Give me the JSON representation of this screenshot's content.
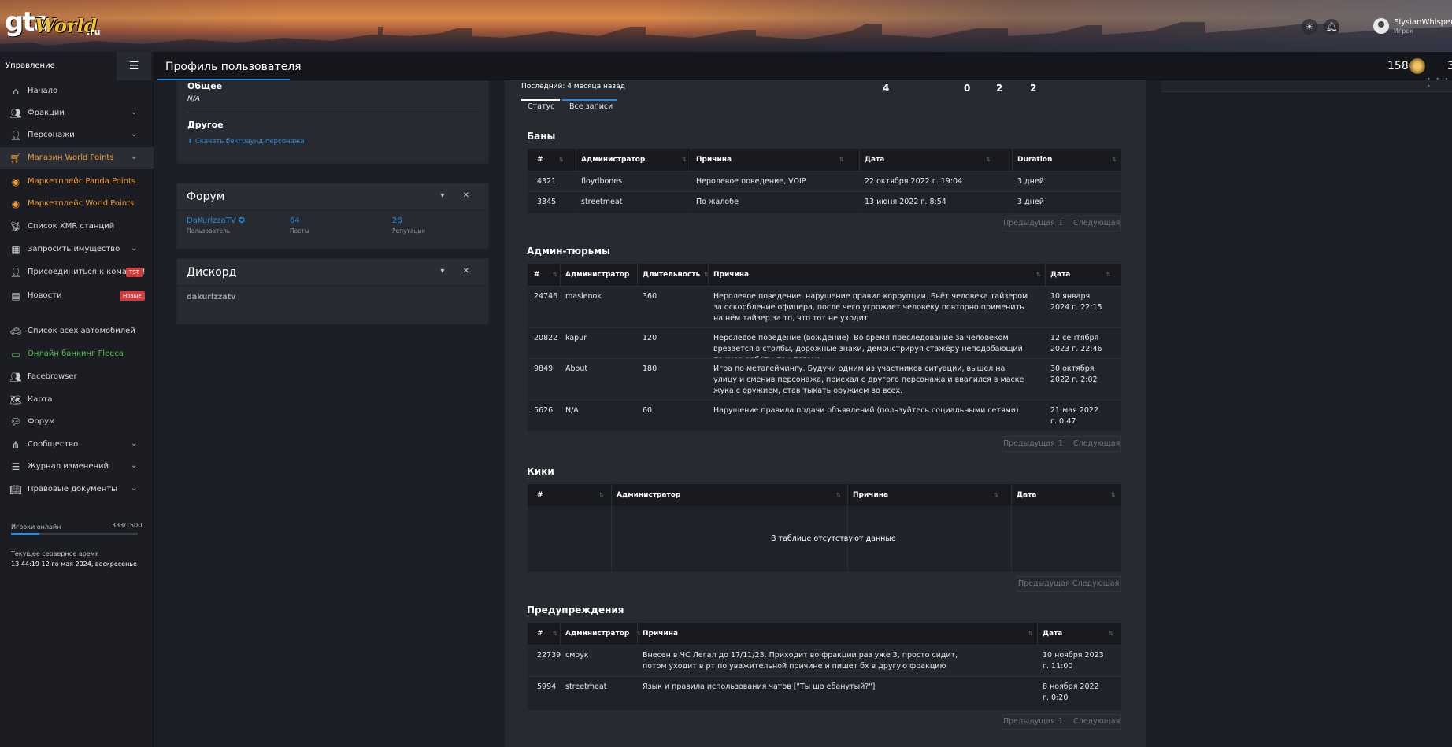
{
  "header": {
    "logo": {
      "gta": "gta",
      "world": "World",
      "ru": ".ru"
    },
    "icons": [
      "sun-icon",
      "bell-icon"
    ],
    "user": {
      "name": "ElysianWhisper",
      "role": "Игрок"
    },
    "points": "158",
    "points_secondary": "3"
  },
  "topbar": {
    "sidebar_title": "Управление",
    "page_title": "Профиль пользователя"
  },
  "sidebar": {
    "items": [
      {
        "label": "Начало",
        "icon": "home-icon",
        "chevron": false
      },
      {
        "label": "Фракции",
        "icon": "users-icon",
        "chevron": true
      },
      {
        "label": "Персонажи",
        "icon": "user-icon",
        "chevron": true
      },
      {
        "label": "Магазин World Points",
        "icon": "cart-icon",
        "chevron": true,
        "color": "orange",
        "active": true
      },
      {
        "label": "Маркетплейс Panda Points",
        "icon": "coins-icon",
        "chevron": false,
        "color": "orange"
      },
      {
        "label": "Маркетплейс World Points",
        "icon": "coins-icon",
        "chevron": false,
        "color": "orange"
      },
      {
        "label": "Список ХМR станций",
        "icon": "radio-tower-icon",
        "chevron": false
      },
      {
        "label": "Запросить имущество",
        "icon": "building-icon",
        "chevron": true
      },
      {
        "label": "Присоединиться к команде!",
        "icon": "user-plus-icon",
        "chevron": false,
        "badge": "TST"
      },
      {
        "label": "Новости",
        "icon": "newspaper-icon",
        "chevron": false,
        "badge": "Новые"
      },
      {
        "label": "Список всех автомобилей",
        "icon": "car-icon",
        "chevron": false
      },
      {
        "label": "Онлайн банкинг Fleeca",
        "icon": "money-icon",
        "chevron": false,
        "color": "green"
      },
      {
        "label": "Facebrowser",
        "icon": "users-icon",
        "chevron": false
      },
      {
        "label": "Карта",
        "icon": "map-icon",
        "chevron": false
      },
      {
        "label": "Форум",
        "icon": "comments-icon",
        "chevron": false
      },
      {
        "label": "Сообщество",
        "icon": "share-icon",
        "chevron": true
      },
      {
        "label": "Журнал изменений",
        "icon": "list-icon",
        "chevron": true
      },
      {
        "label": "Правовые документы",
        "icon": "book-icon",
        "chevron": true
      }
    ],
    "online_label": "Игроки онлайн",
    "online_count": "333/1500",
    "online_fraction": 0.222,
    "time_label": "Текущее серверное время",
    "time_value": "13:44:19 12-го мая 2024, воскресенье"
  },
  "left": {
    "general_label": "Общее",
    "general_value": "N/A",
    "other_label": "Другое",
    "download_link": "⬇ Скачать бекграунд персонажа",
    "forum": {
      "title": "Форум",
      "username": "DaKurlzzaTV",
      "username_label": "Пользователь",
      "posts": "64",
      "posts_label": "Посты",
      "reputation": "28",
      "reputation_label": "Репутация"
    },
    "discord": {
      "title": "Дискорд",
      "username": "dakurlzzatv"
    }
  },
  "main": {
    "last_seen": "Последний: 4 месяца назад",
    "stats": [
      "4",
      "0",
      "2",
      "2"
    ],
    "tabs": [
      "Статус",
      "Все записи"
    ],
    "pager": {
      "prev": "Предыдущая",
      "next": "Следующая",
      "page": "1"
    },
    "bans": {
      "title": "Баны",
      "headers": [
        "#",
        "Администратор",
        "Причина",
        "Дата",
        "Duration"
      ],
      "rows": [
        [
          "4321",
          "floydbones",
          "Неролевое поведение, VOIP.",
          "22 октября 2022 г. 19:04",
          "3 дней"
        ],
        [
          "3345",
          "streetmeat",
          "По жалобе",
          "13 июня 2022 г. 8:54",
          "3 дней"
        ]
      ]
    },
    "jails": {
      "title": "Админ-тюрьмы",
      "headers": [
        "#",
        "Администратор",
        "Длительность",
        "Причина",
        "Дата"
      ],
      "rows": [
        [
          "24746",
          "maslenok",
          "360",
          "Неролевое поведение, нарушение правил коррупции. Бьёт человека тайзером за оскорбление офицера, после чего угрожает человеку повторно применить на нём тайзер за то, что тот не уходит",
          "10 января 2024 г. 22:15"
        ],
        [
          "20822",
          "kapur",
          "120",
          "Неролевое поведение (вождение). Во время преследование за человеком врезается в столбы, дорожные знаки, демонстрируя стажёру неподобающий пример работы при погоне.",
          "12 сентября 2023 г. 22:46"
        ],
        [
          "9849",
          "About",
          "180",
          "Игра по метагеймингу. Будучи одним из участников ситуации, вышел на улицу и сменив персонажа, приехал с другого персонажа и ввалился в маске жука с оружием, став тыкать оружием во всех.",
          "30 октября 2022 г. 2:02"
        ],
        [
          "5626",
          "N/A",
          "60",
          "Нарушение правила подачи объявлений (пользуйтесь социальными сетями).",
          "21 мая 2022 г. 0:47"
        ]
      ]
    },
    "kicks": {
      "title": "Кики",
      "headers": [
        "#",
        "Администратор",
        "Причина",
        "Дата"
      ],
      "empty": "В таблице отсутствуют данные"
    },
    "warnings": {
      "title": "Предупреждения",
      "headers": [
        "#",
        "Администратор",
        "Причина",
        "Дата"
      ],
      "rows": [
        [
          "22739",
          "смоук",
          "Внесен в ЧС Легал до 17/11/23. Приходит во фракции раз уже 3, просто сидит, потом уходит в рт по уважительной причине и пишет бх в другую фракцию",
          "10 ноября 2023 г. 11:00"
        ],
        [
          "5994",
          "streetmeat",
          "Язык и правила использования чатов [\"Ты шо ебанутый?\"]",
          "8 ноября 2022 г. 0:20"
        ]
      ]
    }
  },
  "colors": {
    "accent": "#2b8ad9",
    "orange": "#f29a2e",
    "green": "#4ec34a",
    "badge": "#d13b3b"
  }
}
